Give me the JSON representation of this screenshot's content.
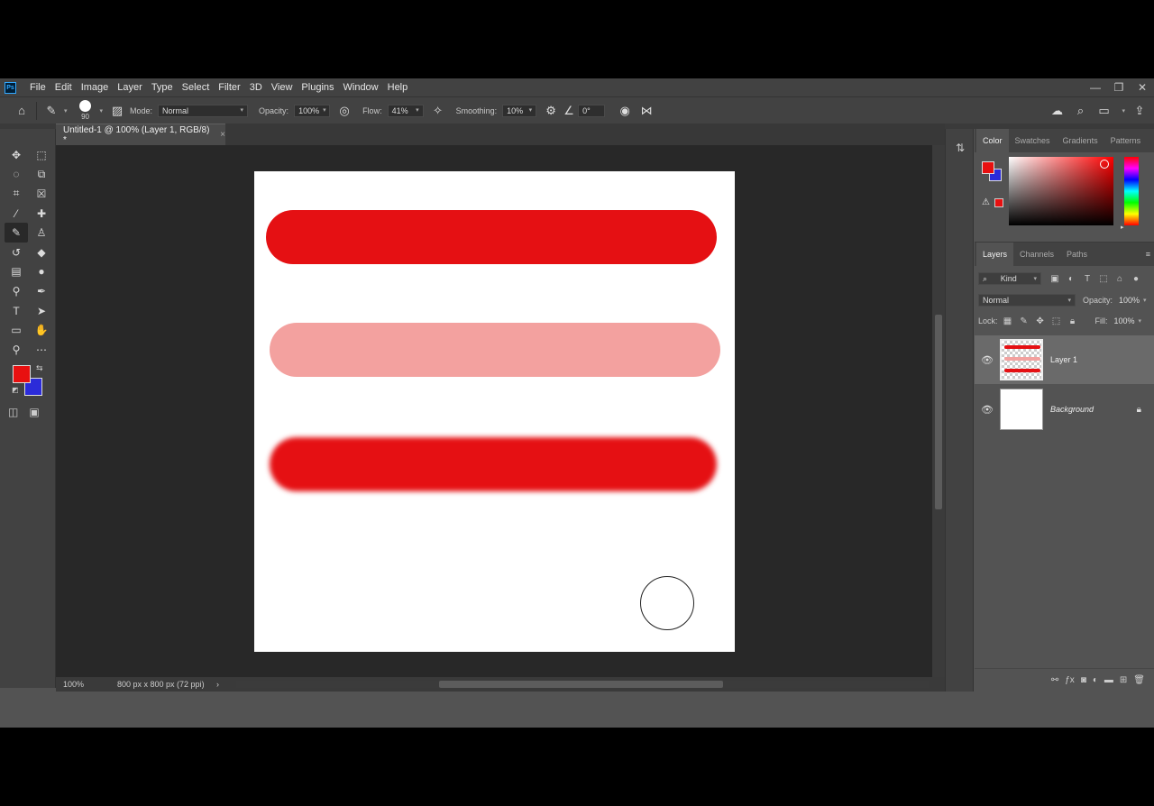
{
  "menu": {
    "logo": "Ps",
    "items": [
      "File",
      "Edit",
      "Image",
      "Layer",
      "Type",
      "Select",
      "Filter",
      "3D",
      "View",
      "Plugins",
      "Window",
      "Help"
    ],
    "window_controls": [
      "—",
      "❐",
      "✕"
    ]
  },
  "options": {
    "brush_size": "90",
    "mode_label": "Mode:",
    "mode_value": "Normal",
    "opacity_label": "Opacity:",
    "opacity_value": "100%",
    "flow_label": "Flow:",
    "flow_value": "41%",
    "smoothing_label": "Smoothing:",
    "smoothing_value": "10%",
    "angle_value": "0°"
  },
  "document": {
    "tab_title": "Untitled-1 @ 100% (Layer 1, RGB/8) *",
    "zoom": "100%",
    "doc_info": "800 px x 800 px (72 ppi)"
  },
  "colors": {
    "foreground": "#e81010",
    "background": "#2b2bd9",
    "stroke_solid": "#e51013",
    "stroke_light": "#f3a19f"
  },
  "color_panel": {
    "tabs": [
      "Color",
      "Swatches",
      "Gradients",
      "Patterns"
    ]
  },
  "layers_panel": {
    "tabs": [
      "Layers",
      "Channels",
      "Paths"
    ],
    "kind_label": "Kind",
    "blend_mode": "Normal",
    "opacity_label": "Opacity:",
    "opacity_value": "100%",
    "lock_label": "Lock:",
    "fill_label": "Fill:",
    "fill_value": "100%",
    "layers": [
      {
        "name": "Layer 1"
      },
      {
        "name": "Background"
      }
    ]
  }
}
